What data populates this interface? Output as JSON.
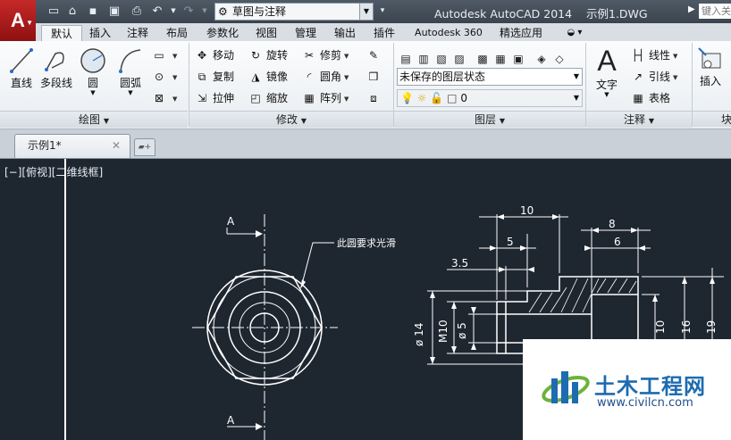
{
  "titlebar": {
    "workspace": "草图与注释",
    "app_title": "Autodesk AutoCAD 2014",
    "file_title": "示例1.DWG",
    "search_placeholder": "键入关"
  },
  "ribbon_tabs": [
    {
      "label": "默认",
      "active": true
    },
    {
      "label": "插入"
    },
    {
      "label": "注释"
    },
    {
      "label": "布局"
    },
    {
      "label": "参数化"
    },
    {
      "label": "视图"
    },
    {
      "label": "管理"
    },
    {
      "label": "输出"
    },
    {
      "label": "插件"
    },
    {
      "label": "Autodesk 360"
    },
    {
      "label": "精选应用"
    }
  ],
  "panels": {
    "draw": {
      "footer": "绘图",
      "line": "直线",
      "polyline": "多段线",
      "circle": "圆",
      "arc": "圆弧"
    },
    "modify": {
      "footer": "修改",
      "move": "移动",
      "rotate": "旋转",
      "trim": "修剪",
      "copy": "复制",
      "mirror": "镜像",
      "fillet": "圆角",
      "stretch": "拉伸",
      "scale": "缩放",
      "array": "阵列"
    },
    "layers": {
      "footer": "图层",
      "layer_state": "未保存的图层状态",
      "current_layer": "0"
    },
    "annotation": {
      "footer": "注释",
      "text": "文字",
      "linear": "线性",
      "leader": "引线",
      "table": "表格"
    },
    "block": {
      "insert": "插入",
      "footer": "块"
    }
  },
  "document_tab": {
    "label": "示例1*"
  },
  "viewport": {
    "label": "[−][俯视][二维线框]"
  },
  "drawing_annotations": {
    "section_mark_top": "A",
    "section_mark_bottom": "A",
    "note": "此圆要求光滑",
    "dimensions": {
      "top_10": "10",
      "top_8": "8",
      "dim_5": "5",
      "dim_6": "6",
      "dim_3_5": "3.5",
      "dia_14": "ø 14",
      "m10": "M10",
      "dia_5": "ø 5",
      "v_10": "10",
      "v_16": "16",
      "v_19": "19"
    }
  },
  "watermark": {
    "title": "土木工程网",
    "url": "www.civilcn.com"
  }
}
